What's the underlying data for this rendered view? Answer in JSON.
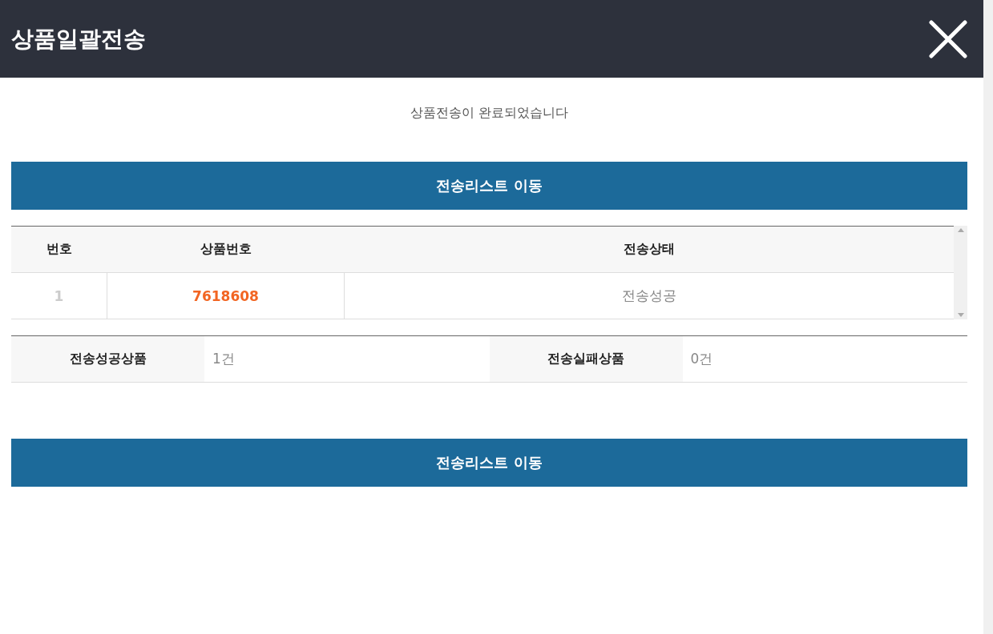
{
  "window": {
    "title": "상품일괄전송"
  },
  "message": "상품전송이 완료되었습니다",
  "top_button": "전송리스트 이동",
  "table": {
    "columns": [
      "번호",
      "상품번호",
      "전송상태"
    ],
    "rows": [
      {
        "number": "1",
        "product_number": "7618608",
        "status": "전송성공"
      }
    ]
  },
  "summary": [
    {
      "label": "전송성공상품",
      "value": "1건"
    },
    {
      "label": "전송실패상품",
      "value": "0건"
    }
  ],
  "bottom_button": "전송리스트 이동"
}
